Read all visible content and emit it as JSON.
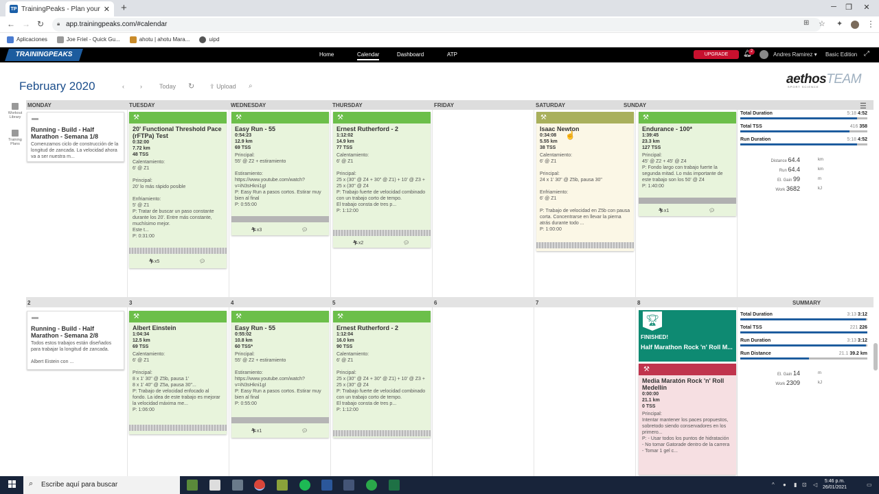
{
  "browser": {
    "tab_title": "TrainingPeaks - Plan your training",
    "favicon_text": "TP",
    "url": "app.trainingpeaks.com/#calendar",
    "bookmarks": [
      "Aplicaciones",
      "Joe Friel - Quick Gu...",
      "ahotu | ahotu Mara...",
      "uipd"
    ]
  },
  "topnav": {
    "logo": "TRAININGPEAKS",
    "items": [
      "Home",
      "Calendar",
      "Dashboard",
      "ATP"
    ],
    "active": "Calendar",
    "upgrade": "UPGRADE",
    "notif_count": "2",
    "user": "Andres Ramirez",
    "edition": "Basic Edition"
  },
  "calendar": {
    "month": "February",
    "year": "2020",
    "today": "Today",
    "upload": "Upload",
    "brand": "aethos",
    "brand2": "TEAM",
    "brand_sub": "SPORT SCIENCE"
  },
  "side": {
    "workout_library": "Workout Library",
    "training_plans": "Training Plans"
  },
  "days": [
    "MONDAY",
    "TUESDAY",
    "WEDNESDAY",
    "THURSDAY",
    "FRIDAY",
    "SATURDAY",
    "SUNDAY"
  ],
  "week2_dates": [
    "2",
    "3",
    "4",
    "5",
    "6",
    "7",
    "8"
  ],
  "summary_label": "SUMMARY",
  "week1": {
    "mon": {
      "title": "Running - Build - Half Marathon - Semana 1/8",
      "desc": "Comenzamos ciclo de construcción de la longitud de zancada. La velocidad ahora va a ser nuestra m..."
    },
    "tue": {
      "title": "20' Functional Threshold Pace (rFTPa) Test",
      "duration": "0:32:00",
      "distance": "7.72 km",
      "tss": "48 TSS",
      "desc": "Calentamiento:\n6' @ Z1\n\nPrincipal:\n20' lo más rápido posible\n\nEnfriamiento:\n5' @ Z1\nP: Tratar de buscar un paso constante durante los 20'. Entre más constante, muchísimo mejor.\nEste t...\nP: 0:31:00",
      "count": "x5"
    },
    "wed": {
      "title": "Easy Run - 55",
      "duration": "0:54:23",
      "distance": "12.9 km",
      "tss": "69 TSS",
      "desc": "Principal:\n55' @ Z2 + estiramiento\n\nEstiramiento:\nhttps://www.youtube.com/watch?v=iN3sHkni1gI\nP: Easy Run a pasos cortos. Estirar muy bien al final\nP: 0:55:00",
      "count": "x3"
    },
    "thu": {
      "title": "Ernest Rutherford - 2",
      "duration": "1:12:02",
      "distance": "14.9 km",
      "tss": "77 TSS",
      "desc": "Calentamiento:\n6' @ Z1\n\nPrincipal:\n25 x (30\" @ Z4 + 30\" @ Z1) + 10' @ Z3 + 25 x (30\" @ Z4\nP: Trabajo fuerte de velocidad combinado con un trabajo corto de tempo.\nEl trabajo consta de tres p...\nP: 1:12:00",
      "count": "x2"
    },
    "sat": {
      "title": "Isaac Newton",
      "duration": "0:34:08",
      "distance": "5.55 km",
      "tss": "38 TSS",
      "desc": "Calentamiento:\n6' @ Z1\n\nPrincipal:\n24 x 1' 30\" @ Z5b, pausa 30\"\n\nEnfriamiento:\n6' @ Z1\n\nP: Trabajo de velocidad en Z5b con pausa corta. Concentrarse en llevar la pierna atrás durante todo ...\nP: 1:00:00"
    },
    "sun": {
      "title": "Endurance - 100*",
      "duration": "1:39:45",
      "distance": "23.3 km",
      "tss": "127 TSS",
      "desc": "Principal:\n45' @ Z2 + 45' @ Z4\nP: Fondo largo con trabajo fuerte la segunda mitad. Lo más importante de este trabajo son los 50' @ Z4\nP: 1:40:00",
      "count": "x1"
    },
    "summary": {
      "rows": [
        {
          "label": "Total Duration",
          "planned": "5:18",
          "actual": "4:52",
          "pct": 0.92
        },
        {
          "label": "Total TSS",
          "planned": "416",
          "actual": "358",
          "pct": 0.86
        },
        {
          "label": "Run Duration",
          "planned": "5:18",
          "actual": "4:52",
          "pct": 0.92
        }
      ],
      "totals": [
        {
          "label": "Distance",
          "value": "64.4",
          "unit": "km"
        },
        {
          "label": "Run",
          "value": "64.4",
          "unit": "km"
        },
        {
          "label": "El. Gain",
          "value": "99",
          "unit": "m"
        },
        {
          "label": "Work",
          "value": "3682",
          "unit": "kJ"
        }
      ]
    }
  },
  "week2": {
    "mon": {
      "title": "Running - Build - Half Marathon - Semana 2/8",
      "desc": "Todos estos trabajos están diseñados para trabajar la longitud de zancada.\n\nAlbert Eistein con ..."
    },
    "tue": {
      "title": "Albert Einstein",
      "duration": "1:04:34",
      "distance": "12.5 km",
      "tss": "69 TSS",
      "desc": "Calentamiento:\n6' @ Z1\n\nPrincipal:\n8 x 1' 30\" @ Z5b, pausa 1'\n8 x 1' 40\" @ Z5a, pausa 30\"...\nP: Trabajo de velocidad enfocado al fondo. La idea de este trabajo es mejorar la velocidad máxima me...\nP: 1:06:00"
    },
    "wed": {
      "title": "Easy Run - 55",
      "duration": "0:55:02",
      "distance": "10.8 km",
      "tss": "60 TSS*",
      "desc": "Principal:\n55' @ Z2 + estiramiento\n\nEstiramiento:\nhttps://www.youtube.com/watch?v=iN3sHkni1gI\nP: Easy Run a pasos cortos. Estirar muy bien al final\nP: 0:55:00",
      "count": "x1"
    },
    "thu": {
      "title": "Ernest Rutherford - 2",
      "duration": "1:12:04",
      "distance": "16.0 km",
      "tss": "90 TSS",
      "desc": "Calentamiento:\n6' @ Z1\n\nPrincipal:\n25 x (30\" @ Z4 + 30\" @ Z1) + 10' @ Z3 + 25 x (30\" @ Z4\nP: Trabajo fuerte de velocidad combinado con un trabajo corto de tempo.\nEl trabajo consta de tres p...\nP: 1:12:00"
    },
    "sun_finished": {
      "label": "FINISHED!",
      "name": "Half Marathon Rock 'n' Roll M..."
    },
    "sun_race": {
      "title": "Media Maratón Rock 'n' Roll Medellín",
      "duration": "0:00:00",
      "distance": "21.1 km",
      "tss": "0 TSS",
      "desc": "Principal:\nIntentar mantener los paces propuestos, sobretodo siendo conservadores en los primero...\nP: - Usar todos los puntos de hidratación\n- No tomar Gatorade dentro de la carrera\n- Tomar 1 gel c..."
    },
    "summary": {
      "rows": [
        {
          "label": "Total Duration",
          "planned": "3:13",
          "actual": "3:12",
          "pct": 0.99
        },
        {
          "label": "Total TSS",
          "planned": "221",
          "actual": "226",
          "pct": 1.0
        },
        {
          "label": "Run Duration",
          "planned": "3:13",
          "actual": "3:12",
          "pct": 0.99
        },
        {
          "label": "Run Distance",
          "planned": "21.1",
          "actual": "39.2 km",
          "pct": 0.54
        }
      ],
      "totals": [
        {
          "label": "El. Gain",
          "value": "14",
          "unit": "m"
        },
        {
          "label": "Work",
          "value": "2309",
          "unit": "kJ"
        }
      ]
    }
  },
  "taskbar": {
    "search": "Escribe aquí para buscar",
    "time": "5:46 p.m.",
    "date": "26/01/2021"
  }
}
